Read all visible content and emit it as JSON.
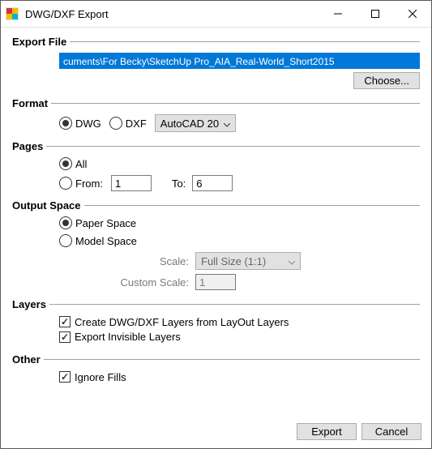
{
  "window": {
    "title": "DWG/DXF Export"
  },
  "exportFile": {
    "label": "Export File",
    "path": "cuments\\For Becky\\SketchUp Pro_AIA_Real-World_Short2015",
    "chooseLabel": "Choose..."
  },
  "format": {
    "label": "Format",
    "dwgLabel": "DWG",
    "dxfLabel": "DXF",
    "versionSelected": "AutoCAD 20"
  },
  "pages": {
    "label": "Pages",
    "allLabel": "All",
    "fromLabel": "From:",
    "toLabel": "To:",
    "fromValue": "1",
    "toValue": "6"
  },
  "outputSpace": {
    "label": "Output Space",
    "paperLabel": "Paper Space",
    "modelLabel": "Model Space",
    "scaleLabel": "Scale:",
    "scaleSelected": "Full Size (1:1)",
    "customScaleLabel": "Custom Scale:",
    "customScaleValue": "1"
  },
  "layers": {
    "label": "Layers",
    "createLabel": "Create DWG/DXF Layers from LayOut Layers",
    "exportInvisibleLabel": "Export Invisible Layers"
  },
  "other": {
    "label": "Other",
    "ignoreFillsLabel": "Ignore Fills"
  },
  "footer": {
    "exportLabel": "Export",
    "cancelLabel": "Cancel"
  }
}
